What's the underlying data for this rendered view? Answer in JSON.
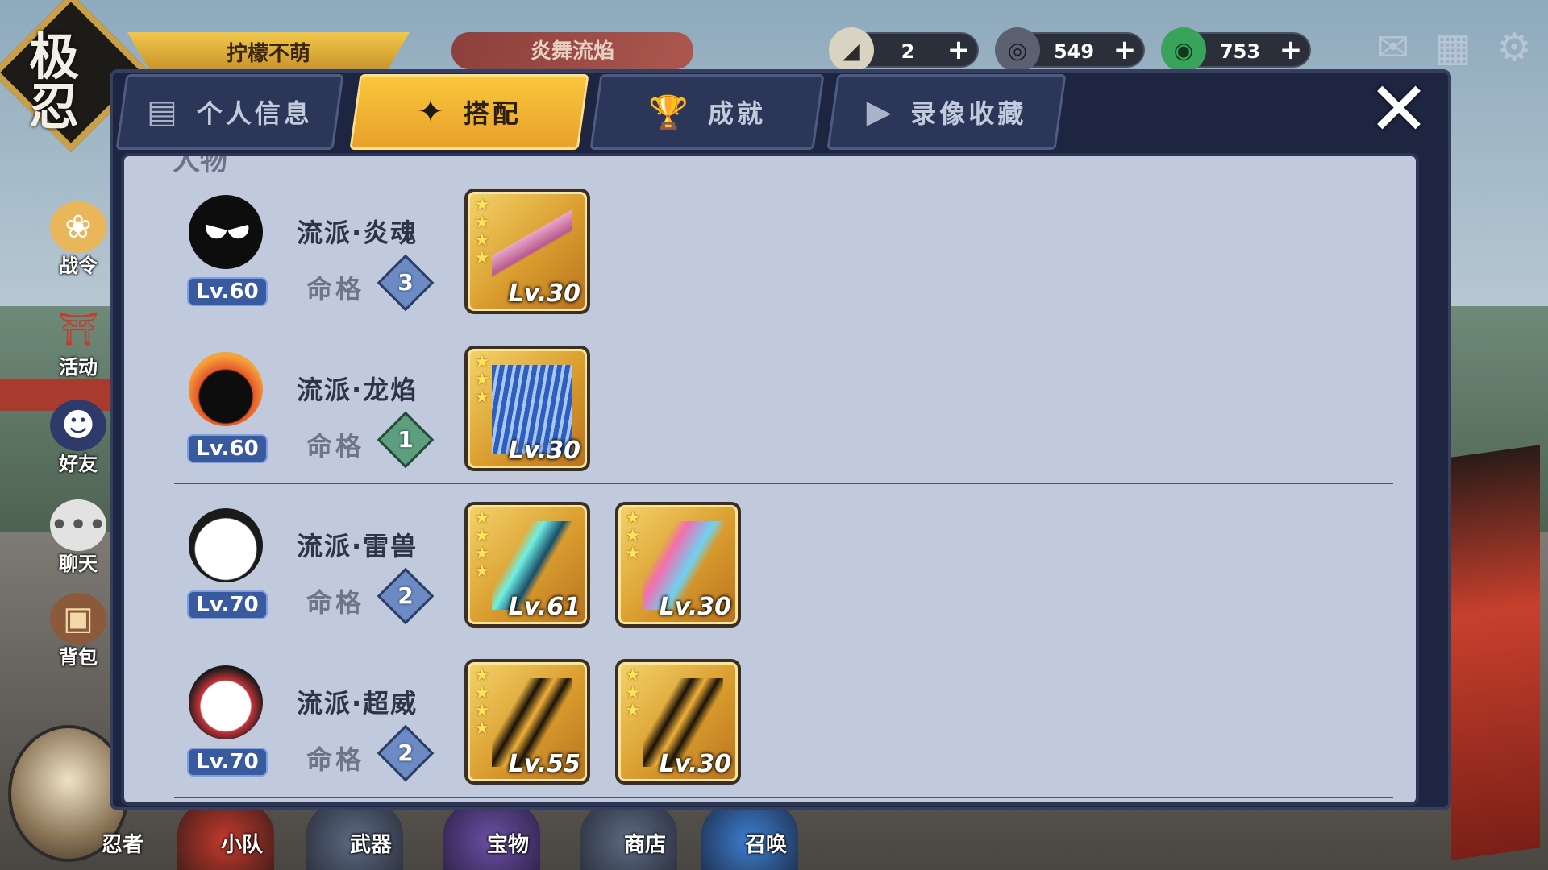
{
  "top_left_logo": "极忍",
  "top_banners": {
    "gold": "拧檬不萌",
    "red": "炎舞流焰"
  },
  "currency": [
    {
      "icon": "onigiri-icon",
      "value": "2"
    },
    {
      "icon": "coin-icon",
      "value": "549万"
    },
    {
      "icon": "jade-icon",
      "value": "753"
    }
  ],
  "top_icons": [
    "mail-icon",
    "gift-icon",
    "settings-icon"
  ],
  "side_menu": [
    "战令",
    "活动",
    "好友",
    "聊天",
    "背包"
  ],
  "bottom_nav": [
    "忍者",
    "小队",
    "武器",
    "宝物",
    "商店",
    "召唤"
  ],
  "tabs": [
    {
      "label": "个人信息",
      "icon": "profile-icon",
      "active": false
    },
    {
      "label": "搭配",
      "icon": "shuriken-icon",
      "active": true
    },
    {
      "label": "成就",
      "icon": "trophy-icon",
      "active": false
    },
    {
      "label": "录像收藏",
      "icon": "play-icon",
      "active": false
    }
  ],
  "section_fragment": "人物",
  "fate_label": "命格",
  "characters": [
    {
      "level": "Lv.60",
      "school": "流派·炎魂",
      "fate": "3",
      "weapons": [
        {
          "stars": 4,
          "level": "Lv.30",
          "art": "pink-bow"
        }
      ]
    },
    {
      "level": "Lv.60",
      "school": "流派·龙焰",
      "fate": "1",
      "weapons": [
        {
          "stars": 3,
          "level": "Lv.30",
          "art": "ice-fan"
        }
      ]
    },
    {
      "level": "Lv.70",
      "school": "流派·雷兽",
      "fate": "2",
      "weapons": [
        {
          "stars": 4,
          "level": "Lv.61",
          "art": "cyan-blade"
        },
        {
          "stars": 3,
          "level": "Lv.30",
          "art": "phone"
        }
      ]
    },
    {
      "level": "Lv.70",
      "school": "流派·超威",
      "fate": "2",
      "weapons": [
        {
          "stars": 4,
          "level": "Lv.55",
          "art": "dark-blade"
        },
        {
          "stars": 3,
          "level": "Lv.30",
          "art": "dark-blade"
        }
      ]
    }
  ],
  "colors": {
    "tab_active": "#f9c73c",
    "panel": "#1d2540",
    "content": "#c1cadc",
    "lv_badge": "#3a5aa0"
  }
}
